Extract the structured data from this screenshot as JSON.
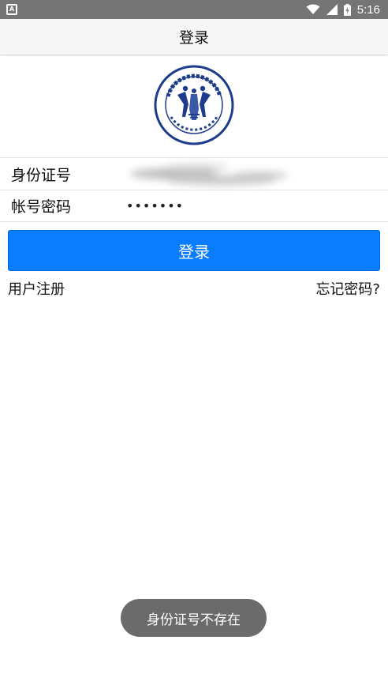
{
  "status_bar": {
    "app_icon_letter": "A",
    "time": "5:16",
    "icons": [
      "wifi-icon",
      "signal-icon",
      "battery-icon"
    ]
  },
  "header": {
    "title": "登录"
  },
  "form": {
    "id_label": "身份证号",
    "id_value": "",
    "password_label": "帐号密码",
    "password_value": "•••••••"
  },
  "actions": {
    "login_label": "登录",
    "register_label": "用户注册",
    "forgot_label": "忘记密码?"
  },
  "toast": {
    "message": "身份证号不存在"
  },
  "colors": {
    "primary": "#0a7cff",
    "status_bar": "#757575",
    "logo_blue": "#1e3c8c",
    "toast_bg": "#6b6b6b"
  }
}
